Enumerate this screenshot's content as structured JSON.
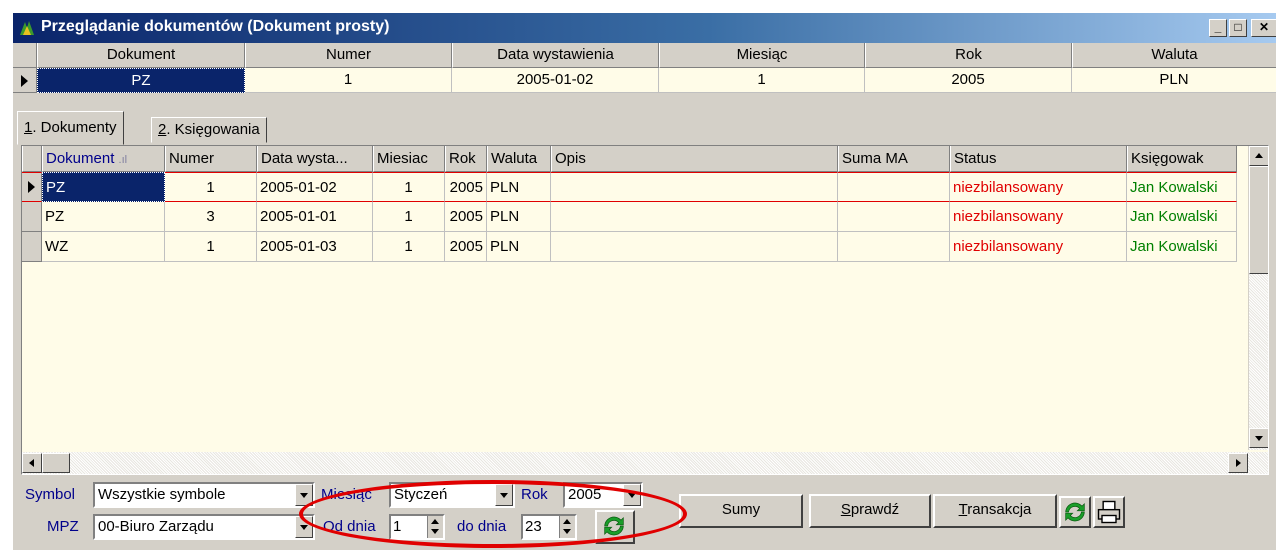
{
  "window": {
    "title": "Przeglądanie dokumentów (Dokument prosty)",
    "controls": [
      "_",
      "□",
      "✕"
    ]
  },
  "header_grid": {
    "columns": [
      "Dokument",
      "Numer",
      "Data wystawienia",
      "Miesiąc",
      "Rok",
      "Waluta"
    ],
    "row": [
      "PZ",
      "1",
      "2005-01-02",
      "1",
      "2005",
      "PLN"
    ]
  },
  "tabs": [
    {
      "num": "1",
      "label": ". Dokumenty"
    },
    {
      "num": "2",
      "label": ". Księgowania"
    }
  ],
  "grid": {
    "columns": [
      "Dokument",
      "Numer",
      "Data wysta...",
      "Miesiac",
      "Rok",
      "Waluta",
      "Opis",
      "Suma MA",
      "Status",
      "Księgowak"
    ],
    "rows": [
      [
        "PZ",
        "1",
        "2005-01-02",
        "1",
        "2005",
        "PLN",
        "",
        "",
        "niezbilansowany",
        "Jan Kowalski"
      ],
      [
        "PZ",
        "3",
        "2005-01-01",
        "1",
        "2005",
        "PLN",
        "",
        "",
        "niezbilansowany",
        "Jan Kowalski"
      ],
      [
        "WZ",
        "1",
        "2005-01-03",
        "1",
        "2005",
        "PLN",
        "",
        "",
        "niezbilansowany",
        "Jan Kowalski"
      ]
    ]
  },
  "filters": {
    "symbol_label": "Symbol",
    "symbol_value": "Wszystkie symbole",
    "mpz_label": "MPZ",
    "mpz_value": "00-Biuro Zarządu",
    "miesiac_label": "Miesiąc",
    "miesiac_value": "Styczeń",
    "rok_label": "Rok",
    "rok_value": "2005",
    "od_label": "Od dnia",
    "od_value": "1",
    "do_label": "do dnia",
    "do_value": "23"
  },
  "buttons": {
    "sumy": "Sumy",
    "sprawdz_u": "S",
    "sprawdz_rest": "prawdź",
    "transakcja_u": "T",
    "transakcja_rest": "ransakcja"
  },
  "colors": {
    "status_text": "#e00000",
    "user_text": "#008000",
    "annotation": "#e00000",
    "refresh_icon": "#1a9e2a"
  }
}
